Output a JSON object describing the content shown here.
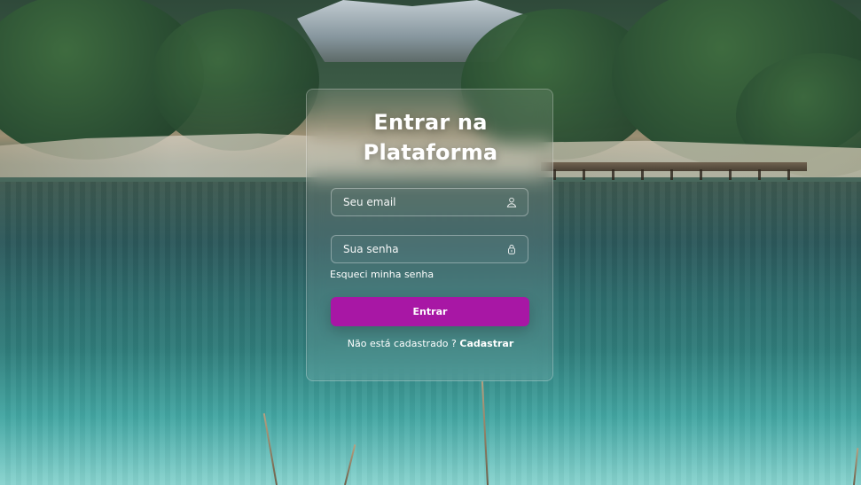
{
  "login": {
    "title_line1": "Entrar na",
    "title_line2": "Plataforma",
    "email_placeholder": "Seu email",
    "password_placeholder": "Sua senha",
    "forgot_password": "Esqueci minha senha",
    "submit_label": "Entrar",
    "signup_prompt": "Não está cadastrado ?",
    "signup_link": "Cadastrar"
  },
  "icons": {
    "email_field_icon": "user-icon",
    "password_field_icon": "lock-icon"
  },
  "colors": {
    "primary_button": "#a817a5",
    "text": "#ffffff"
  }
}
